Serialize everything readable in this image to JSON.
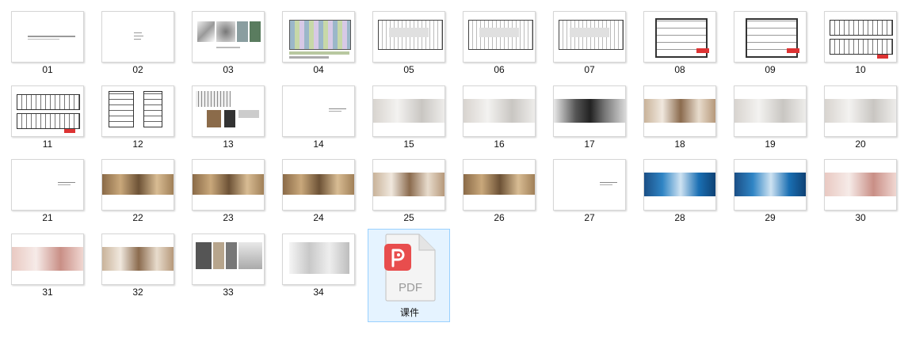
{
  "files": [
    {
      "name": "01",
      "kind": "title"
    },
    {
      "name": "02",
      "kind": "toc"
    },
    {
      "name": "03",
      "kind": "mood"
    },
    {
      "name": "04",
      "kind": "plan-color"
    },
    {
      "name": "05",
      "kind": "plan"
    },
    {
      "name": "06",
      "kind": "plan"
    },
    {
      "name": "07",
      "kind": "plan"
    },
    {
      "name": "08",
      "kind": "plan-small"
    },
    {
      "name": "09",
      "kind": "plan-small"
    },
    {
      "name": "10",
      "kind": "elevation"
    },
    {
      "name": "11",
      "kind": "elevation"
    },
    {
      "name": "12",
      "kind": "detail"
    },
    {
      "name": "13",
      "kind": "collage"
    },
    {
      "name": "14",
      "kind": "section"
    },
    {
      "name": "15",
      "kind": "render-white"
    },
    {
      "name": "16",
      "kind": "render-white"
    },
    {
      "name": "17",
      "kind": "render-dark"
    },
    {
      "name": "18",
      "kind": "render-warm"
    },
    {
      "name": "19",
      "kind": "render-white"
    },
    {
      "name": "20",
      "kind": "render-white"
    },
    {
      "name": "21",
      "kind": "section"
    },
    {
      "name": "22",
      "kind": "render-wood"
    },
    {
      "name": "23",
      "kind": "render-wood"
    },
    {
      "name": "24",
      "kind": "render-wood"
    },
    {
      "name": "25",
      "kind": "render-warm"
    },
    {
      "name": "26",
      "kind": "render-wood"
    },
    {
      "name": "27",
      "kind": "section"
    },
    {
      "name": "28",
      "kind": "render-blue"
    },
    {
      "name": "29",
      "kind": "render-blue"
    },
    {
      "name": "30",
      "kind": "render-pink"
    },
    {
      "name": "31",
      "kind": "render-pink"
    },
    {
      "name": "32",
      "kind": "render-warm"
    },
    {
      "name": "33",
      "kind": "material"
    },
    {
      "name": "34",
      "kind": "render-gray"
    }
  ],
  "pdf_file": {
    "name": "课件",
    "icon": "pdf-file-icon",
    "badge_text": "PDF",
    "accent": "#e84d4d"
  },
  "colors": {
    "selection_bg": "#e5f3ff",
    "selection_border": "#99d1ff"
  }
}
